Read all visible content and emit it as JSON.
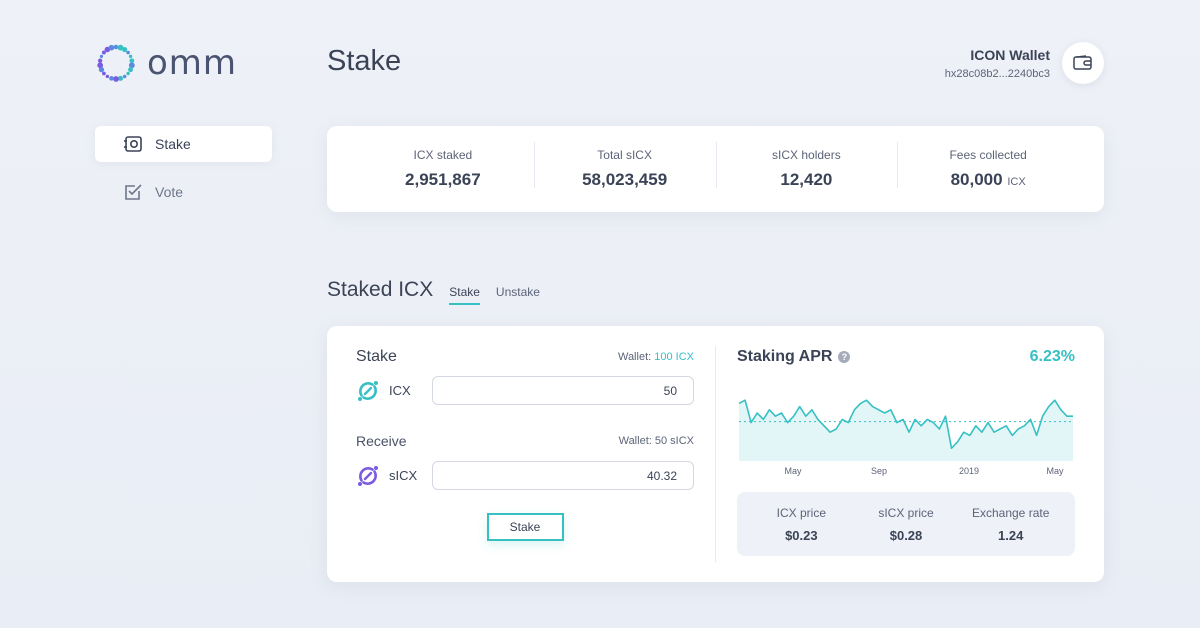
{
  "brand": {
    "name": "omm",
    "accent": "#37c0c4"
  },
  "sidebar": {
    "items": [
      {
        "label": "Stake",
        "icon": "stake-icon",
        "active": true
      },
      {
        "label": "Vote",
        "icon": "vote-checkbox-icon",
        "active": false
      }
    ]
  },
  "header": {
    "title": "Stake",
    "wallet_name": "ICON Wallet",
    "wallet_address": "hx28c08b2...2240bc3",
    "wallet_icon": "wallet-icon"
  },
  "stats": [
    {
      "label": "ICX staked",
      "value": "2,951,867",
      "unit": ""
    },
    {
      "label": "Total sICX",
      "value": "58,023,459",
      "unit": ""
    },
    {
      "label": "sICX holders",
      "value": "12,420",
      "unit": ""
    },
    {
      "label": "Fees collected",
      "value": "80,000",
      "unit": "ICX"
    }
  ],
  "section": {
    "title": "Staked ICX",
    "tabs": [
      {
        "label": "Stake",
        "active": true
      },
      {
        "label": "Unstake",
        "active": false
      }
    ]
  },
  "stake_form": {
    "title": "Stake",
    "wallet_prefix": "Wallet:",
    "wallet_amount": "100 ICX",
    "input_token": "ICX",
    "input_value": "50",
    "receive_label": "Receive",
    "receive_wallet": "Wallet: 50 sICX",
    "output_token": "sICX",
    "output_value": "40.32",
    "button_label": "Stake"
  },
  "apr": {
    "title": "Staking APR",
    "help_icon": "question-icon",
    "value": "6.23%"
  },
  "prices": [
    {
      "label": "ICX price",
      "value": "$0.23"
    },
    {
      "label": "sICX price",
      "value": "$0.28"
    },
    {
      "label": "Exchange rate",
      "value": "1.24"
    }
  ],
  "chart_data": {
    "type": "area",
    "title": "Staking APR",
    "xlabel": "",
    "ylabel": "",
    "x_ticks": [
      "May",
      "Sep",
      "2019",
      "May"
    ],
    "reference_line": 6.23,
    "ylim": [
      5.0,
      7.5
    ],
    "series": [
      {
        "values": [
          6.8,
          6.9,
          6.2,
          6.5,
          6.3,
          6.6,
          6.4,
          6.5,
          6.2,
          6.4,
          6.7,
          6.4,
          6.6,
          6.3,
          6.1,
          5.9,
          6.0,
          6.3,
          6.2,
          6.6,
          6.8,
          6.9,
          6.7,
          6.6,
          6.5,
          6.6,
          6.2,
          6.3,
          5.9,
          6.3,
          6.1,
          6.3,
          6.2,
          6.0,
          6.4,
          5.4,
          5.6,
          5.9,
          5.8,
          6.1,
          5.9,
          6.2,
          5.9,
          6.0,
          6.1,
          5.8,
          6.0,
          6.1,
          6.3,
          5.8,
          6.4,
          6.7,
          6.9,
          6.6,
          6.4,
          6.4
        ],
        "color": "#37c0c4"
      }
    ]
  }
}
